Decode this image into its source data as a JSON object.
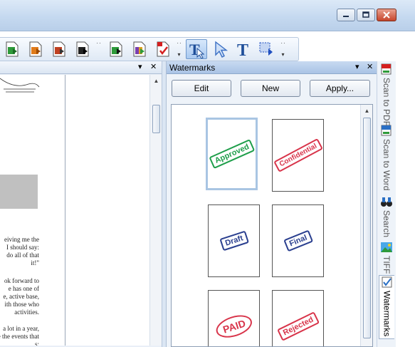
{
  "window": {
    "caption_buttons": [
      "minimize",
      "restore",
      "close"
    ]
  },
  "toolbar": {
    "buttons": [
      {
        "name": "convert-green-icon",
        "color": "#2e9a3a"
      },
      {
        "name": "convert-orange-icon",
        "color": "#e07b1a"
      },
      {
        "name": "convert-image-icon",
        "color": "#c04020"
      },
      {
        "name": "convert-black-icon",
        "color": "#222222"
      },
      {
        "name": "combine-green-icon",
        "color": "#2e9a3a"
      },
      {
        "name": "combine-purple-icon",
        "color": "#7a3fb0"
      },
      {
        "name": "check-document-icon",
        "color": "#d42020"
      },
      {
        "name": "touchup-text-select-icon",
        "color": "#1f4f9a"
      },
      {
        "name": "select-arrow-icon",
        "color": "#3a6fc4"
      },
      {
        "name": "text-tool-icon",
        "color": "#1f4f9a"
      },
      {
        "name": "select-area-icon",
        "color": "#2050c0"
      }
    ]
  },
  "document_pane": {
    "text_lines_1": [
      "eiving me the",
      "I should say:",
      "do all of that",
      "it!\""
    ],
    "text_lines_2": [
      "ok forward to",
      "e has one of",
      "e, active base,",
      "ith those who",
      "activities."
    ],
    "text_lines_3": [
      "a lot in a year,",
      "e the events that",
      "s:"
    ]
  },
  "watermarks_panel": {
    "title": "Watermarks",
    "buttons": {
      "edit": "Edit",
      "new": "New",
      "apply": "Apply..."
    },
    "items": [
      {
        "text": "Approved",
        "color": "#1e9e4a",
        "selected": true
      },
      {
        "text": "Confidential",
        "color": "#d8344a",
        "selected": false
      },
      {
        "text": "Draft",
        "color": "#2a3f8f",
        "selected": false
      },
      {
        "text": "Final",
        "color": "#2a3f8f",
        "selected": false
      },
      {
        "text": "PAID",
        "color": "#d8344a",
        "selected": false
      },
      {
        "text": "Rejected",
        "color": "#d8344a",
        "selected": false
      }
    ]
  },
  "side_tabs": [
    {
      "label": "Scan to PDF",
      "icon": "scan-pdf-icon"
    },
    {
      "label": "Scan to Word",
      "icon": "scan-word-icon"
    },
    {
      "label": "Search",
      "icon": "search-binoculars-icon"
    },
    {
      "label": "TIFF",
      "icon": "tiff-image-icon"
    },
    {
      "label": "Watermarks",
      "icon": "watermark-check-icon",
      "active": true
    }
  ]
}
